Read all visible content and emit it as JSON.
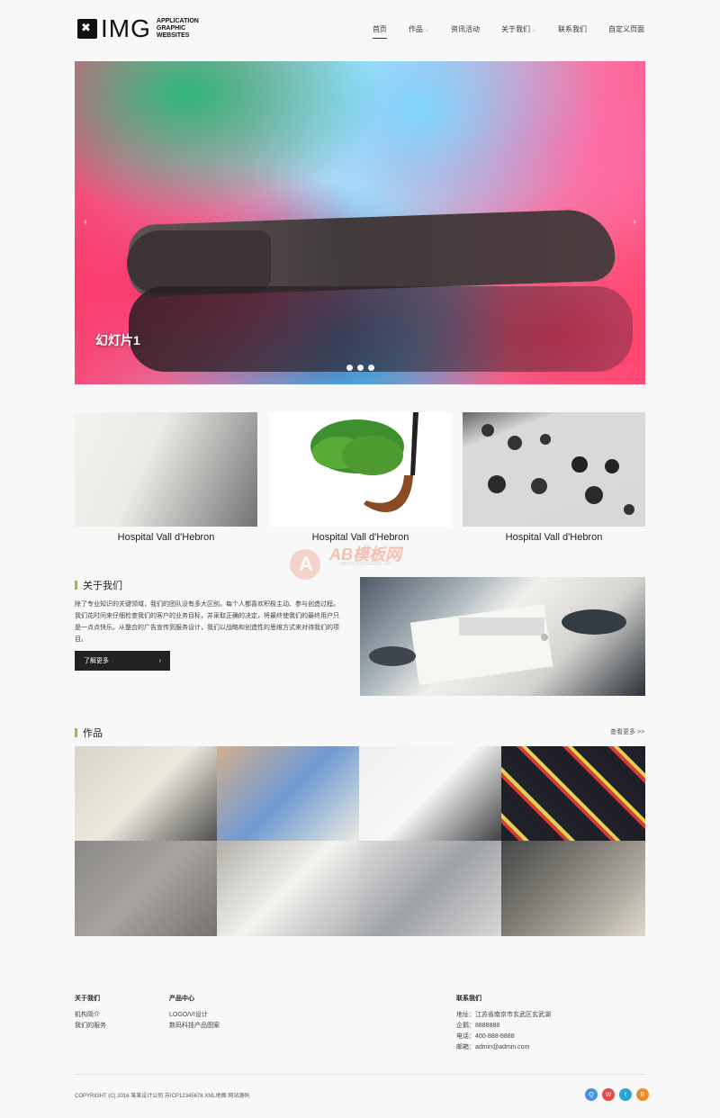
{
  "brand": {
    "logo": "IMG",
    "logo_sub": [
      "APPLICATION",
      "GRAPHIC",
      "WEBSITES"
    ]
  },
  "nav": {
    "items": [
      {
        "label": "首页",
        "active": true
      },
      {
        "label": "作品",
        "caret": "⌄"
      },
      {
        "label": "资讯活动"
      },
      {
        "label": "关于我们",
        "caret": "⌄"
      },
      {
        "label": "联系我们"
      },
      {
        "label": "自定义页面"
      }
    ]
  },
  "slider": {
    "caption": "幻灯片1",
    "arrow_left": "‹",
    "arrow_right": "›"
  },
  "features": [
    {
      "title": "Hospital Vall d'Hebron"
    },
    {
      "title": "Hospital Vall d'Hebron"
    },
    {
      "title": "Hospital Vall d'Hebron"
    }
  ],
  "watermark": {
    "letter": "A",
    "text": "AB模板网",
    "sub": "www.Abmobao.cn"
  },
  "about": {
    "title": "关于我们",
    "text": "除了专业知识的关键领域，我们的团队没有多大区别。每个人都喜欢积极主动、参与创造过程。我们花时间来仔细检查我们的客户的业务目标，并采取正确的决定，将最终使我们的最终用户只是一点点快乐。从整合的广告宣传到服务设计，我们以战略和创造性的思维方式来对待我们的项目。",
    "button": "了解更多",
    "button_arrow": "›"
  },
  "works": {
    "title": "作品",
    "more": "查看更多 >>",
    "tiles": 8
  },
  "footer": {
    "col1": {
      "title": "关于我们",
      "links": [
        "机构简介",
        "我们的服务"
      ]
    },
    "col2": {
      "title": "产品中心",
      "links": [
        "LOGO/VI设计",
        "数码科技产品图案"
      ]
    },
    "col3": {
      "title": "联系我们",
      "lines": [
        "地址：江苏省南京市玄武区玄武湖",
        "企鹅：8888888",
        "电话：400-888-8888",
        "邮箱：admin@admin.com"
      ]
    },
    "copyright": "COPYRIGHT (C) 2016 某某设计公司 苏ICP12345678 XML地图 网站源码",
    "social": [
      {
        "label": "Q",
        "color": "#4a90e2"
      },
      {
        "label": "W",
        "color": "#e64a4a"
      },
      {
        "label": "t",
        "color": "#25a5d8"
      },
      {
        "label": "R",
        "color": "#f08b2b"
      }
    ]
  }
}
